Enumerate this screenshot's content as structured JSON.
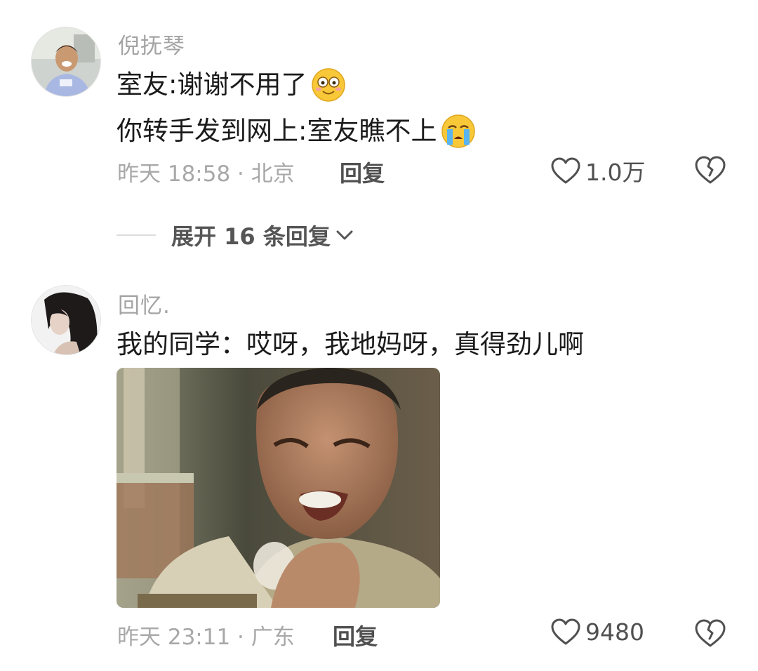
{
  "comments": [
    {
      "username": "倪抚琴",
      "lines": [
        "室友:谢谢不用了",
        "你转手发到网上:室友瞧不上"
      ],
      "emoji_icons": [
        "smiling-face-emoji",
        "crying-face-emoji"
      ],
      "time_location": "昨天 18:58 · 北京",
      "reply_label": "回复",
      "like_count": "1.0万",
      "expand_label": "展开 16 条回复"
    },
    {
      "username": "回忆.",
      "lines": [
        "我的同学：哎呀，我地妈呀，真得劲儿啊"
      ],
      "time_location": "昨天 23:11 · 广东",
      "reply_label": "回复",
      "like_count": "9480"
    }
  ],
  "icons": {
    "like": "heart-outline-icon",
    "dislike": "broken-heart-icon",
    "expand": "chevron-down-icon"
  },
  "colors": {
    "username": "#a4a4a4",
    "meta": "#a8a8a8",
    "text": "#1b1b1b",
    "action": "#505050"
  }
}
